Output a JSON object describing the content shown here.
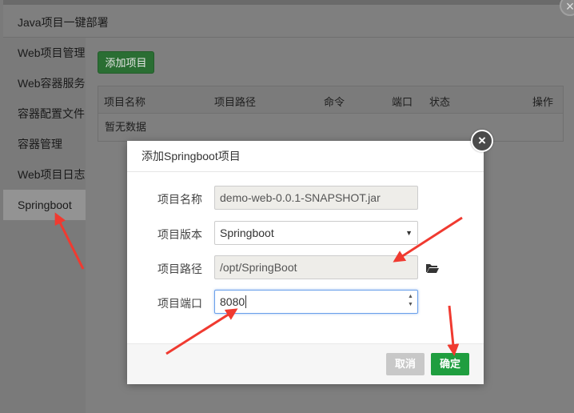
{
  "window": {
    "title": "Java项目一键部署",
    "close_glyph": "×"
  },
  "sidebar": {
    "items": [
      {
        "label": "Web项目管理"
      },
      {
        "label": "Web容器服务"
      },
      {
        "label": "容器配置文件"
      },
      {
        "label": "容器管理"
      },
      {
        "label": "Web项目日志"
      },
      {
        "label": "Springboot",
        "active": true
      }
    ]
  },
  "content": {
    "add_button": "添加项目",
    "table": {
      "headers": [
        "项目名称",
        "项目路径",
        "命令",
        "端口",
        "状态",
        "操作"
      ],
      "empty_text": "暂无数据"
    }
  },
  "dialog": {
    "title": "添加Springboot项目",
    "close_glyph": "×",
    "fields": {
      "name": {
        "label": "项目名称",
        "value": "demo-web-0.0.1-SNAPSHOT.jar"
      },
      "version": {
        "label": "项目版本",
        "value": "Springboot"
      },
      "path": {
        "label": "项目路径",
        "value": "/opt/SpringBoot"
      },
      "port": {
        "label": "项目端口",
        "value": "8080"
      }
    },
    "cancel_label": "取消",
    "confirm_label": "确定"
  },
  "colors": {
    "confirm": "#1f9e3f",
    "cancel": "#c8c8c8",
    "annotation_arrow": "#f03a30"
  },
  "icons": [
    "close-icon",
    "folder-open-icon",
    "chevron-down-icon",
    "spinner-arrows-icon"
  ]
}
